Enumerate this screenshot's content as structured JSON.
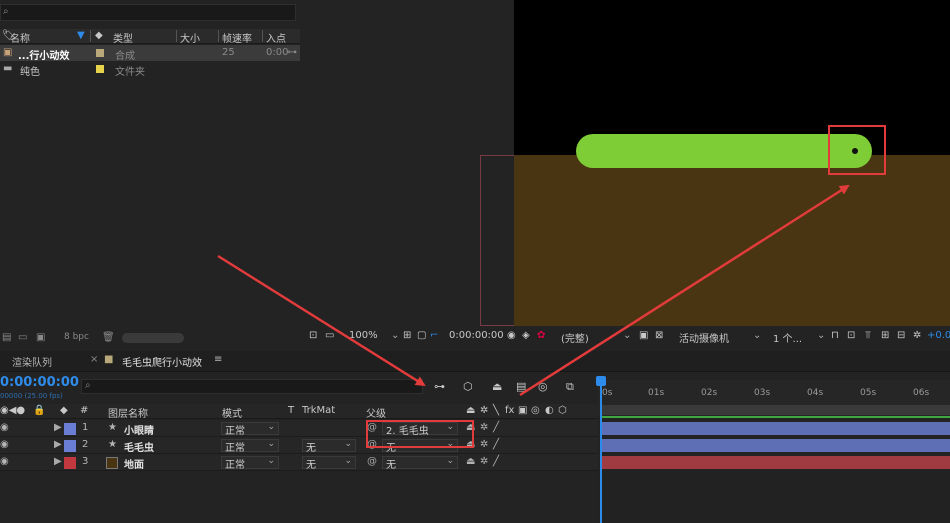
{
  "project": {
    "search_icon": "search-icon",
    "columns": {
      "name": "名称",
      "type": "类型",
      "size": "大小",
      "fps": "帧速率",
      "in": "入点"
    },
    "items": [
      {
        "name": "...行小动效",
        "type": "合成",
        "fps": "25",
        "in": "0:00",
        "color": "#b9a87a"
      },
      {
        "name": "纯色",
        "type": "文件夹",
        "fps": "",
        "in": "",
        "color": "#e6d34a"
      }
    ],
    "footer": {
      "bpc": "8 bpc"
    }
  },
  "viewer": {
    "zoom": "100%",
    "timecode": "0:00:00:00",
    "resolution": "(完整)",
    "camera": "活动摄像机",
    "views": "1 个...",
    "exposure": "+0.0"
  },
  "tabs": {
    "render_queue": "渲染队列",
    "comp": "毛毛虫爬行小动效"
  },
  "timeline": {
    "timecode": "0:00:00:00",
    "fps_sub": "00000 (25.00 fps)",
    "search_placeholder": "",
    "headers": {
      "num": "#",
      "layer_name": "图层名称",
      "mode": "模式",
      "t": "T",
      "trkmat": "TrkMat",
      "parent": "父级",
      "fx": "fx"
    },
    "layers": [
      {
        "num": "1",
        "name": "小眼睛",
        "mode": "正常",
        "trkmat": "",
        "parent": "2. 毛毛虫",
        "color": "#6b7ed6"
      },
      {
        "num": "2",
        "name": "毛毛虫",
        "mode": "正常",
        "trkmat": "无",
        "parent": "无",
        "color": "#6b7ed6"
      },
      {
        "num": "3",
        "name": "地面",
        "mode": "正常",
        "trkmat": "无",
        "parent": "无",
        "color": "#c2383f"
      }
    ],
    "ruler": [
      "0s",
      "01s",
      "02s",
      "03s",
      "04s",
      "05s",
      "06s"
    ],
    "bar_colors": [
      "#5f6fb5",
      "#5f6fb5",
      "#a03b42"
    ]
  }
}
